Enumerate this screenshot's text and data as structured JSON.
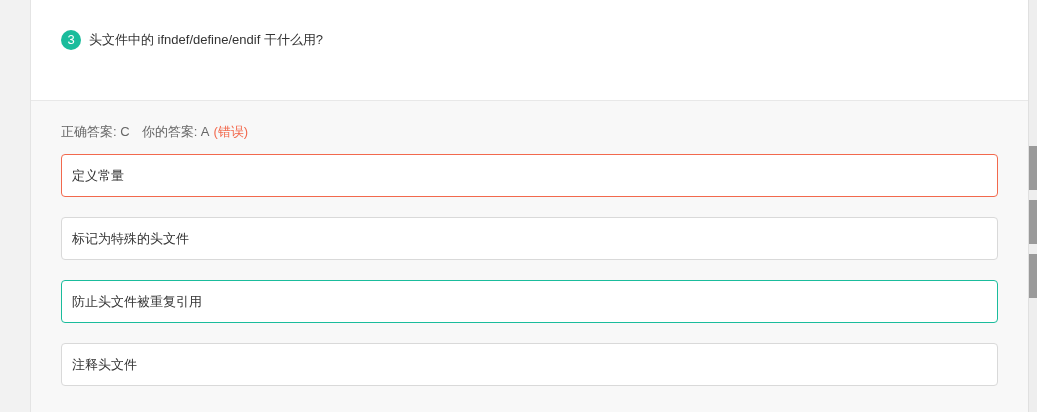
{
  "question": {
    "number": "3",
    "text": "头文件中的 ifndef/define/endif 干什么用?"
  },
  "result": {
    "correct_label": "正确答案: C",
    "your_label": "你的答案: A",
    "verdict": "(错误)"
  },
  "options": [
    {
      "text": "定义常量",
      "kind": "wrong"
    },
    {
      "text": "标记为特殊的头文件",
      "kind": "normal"
    },
    {
      "text": "防止头文件被重复引用",
      "kind": "correct"
    },
    {
      "text": "注释头文件",
      "kind": "normal"
    }
  ]
}
